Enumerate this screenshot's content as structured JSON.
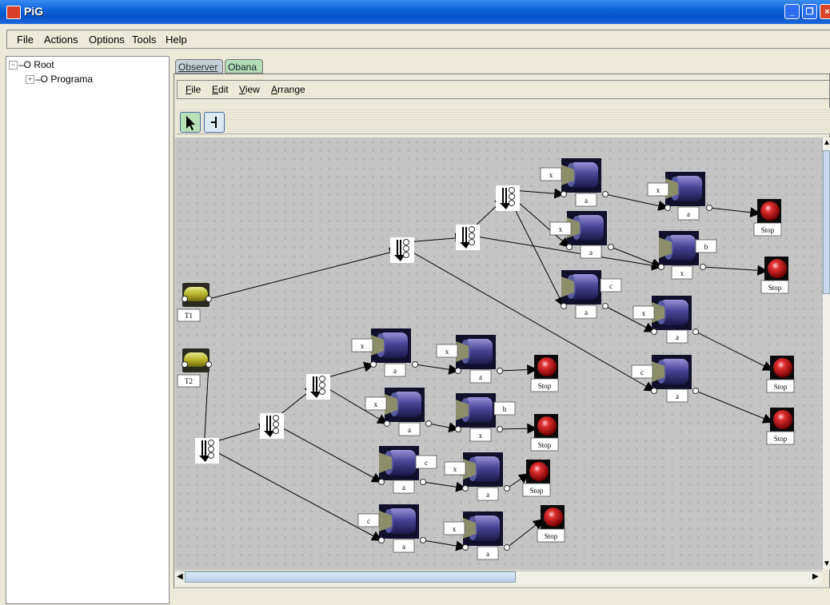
{
  "window": {
    "title": "PiG"
  },
  "menu": [
    "File",
    "Actions",
    "Options",
    "Tools",
    "Help"
  ],
  "tree": {
    "root": "Root",
    "child": "Programa"
  },
  "tabs": {
    "observer": "Observer",
    "obana": "Obana"
  },
  "editor_menu": [
    {
      "u": "F",
      "rest": "ile"
    },
    {
      "u": "E",
      "rest": "dit"
    },
    {
      "u": "V",
      "rest": "iew"
    },
    {
      "u": "A",
      "rest": "rrange"
    }
  ],
  "triggers": [
    {
      "id": "t1",
      "label": "T1"
    },
    {
      "id": "t2",
      "label": "T2"
    }
  ],
  "processes": [
    {
      "id": "p1",
      "top": "x",
      "bottom": "a"
    },
    {
      "id": "p2",
      "top": "x",
      "bottom": "a"
    },
    {
      "id": "p3",
      "top": "x",
      "bottom": "a"
    },
    {
      "id": "p4",
      "top": "b",
      "bottom": "x"
    },
    {
      "id": "p5",
      "top": "c",
      "bottom": "a"
    },
    {
      "id": "p6",
      "top": "x",
      "bottom": "a"
    },
    {
      "id": "p7",
      "top": "c",
      "bottom": "a"
    },
    {
      "id": "p8",
      "top": "x",
      "bottom": "a"
    },
    {
      "id": "p9",
      "top": "x",
      "bottom": "a"
    },
    {
      "id": "p10",
      "top": "x",
      "bottom": "a"
    },
    {
      "id": "p11",
      "top": "b",
      "bottom": "x"
    },
    {
      "id": "p12",
      "top": "c",
      "bottom": "a"
    },
    {
      "id": "p13",
      "top": "x",
      "bottom": "a"
    },
    {
      "id": "p14",
      "top": "c",
      "bottom": "a"
    },
    {
      "id": "p15",
      "top": "x",
      "bottom": "a"
    }
  ],
  "stops": [
    {
      "id": "s1",
      "label": "Stop"
    },
    {
      "id": "s2",
      "label": "Stop"
    },
    {
      "id": "s3",
      "label": "Stop"
    },
    {
      "id": "s4",
      "label": "Stop"
    },
    {
      "id": "s5",
      "label": "Stop"
    },
    {
      "id": "s6",
      "label": "Stop"
    },
    {
      "id": "s7",
      "label": "Stop"
    },
    {
      "id": "s8",
      "label": "Stop"
    }
  ],
  "forks": [
    "f1",
    "f2",
    "f3",
    "f4",
    "f5",
    "f6"
  ],
  "edges": [
    [
      "t1",
      "f1"
    ],
    [
      "t2",
      "f4"
    ],
    [
      "f1",
      "f2"
    ],
    [
      "f1",
      "p7"
    ],
    [
      "f2",
      "f3"
    ],
    [
      "f2",
      "p4"
    ],
    [
      "f3",
      "p1"
    ],
    [
      "f3",
      "p3"
    ],
    [
      "f3",
      "p5"
    ],
    [
      "p1",
      "p2"
    ],
    [
      "p2",
      "s1"
    ],
    [
      "p3",
      "p4"
    ],
    [
      "p4",
      "s2"
    ],
    [
      "p5",
      "p6"
    ],
    [
      "p6",
      "s3"
    ],
    [
      "p7",
      "s4"
    ],
    [
      "f4",
      "f5"
    ],
    [
      "f4",
      "p14"
    ],
    [
      "f5",
      "f6"
    ],
    [
      "f5",
      "p12"
    ],
    [
      "f6",
      "p8"
    ],
    [
      "f6",
      "p10"
    ],
    [
      "p8",
      "p9"
    ],
    [
      "p9",
      "s5"
    ],
    [
      "p10",
      "p11"
    ],
    [
      "p11",
      "s6"
    ],
    [
      "p12",
      "p13"
    ],
    [
      "p13",
      "s7"
    ],
    [
      "p14",
      "p15"
    ],
    [
      "p15",
      "s8"
    ]
  ]
}
